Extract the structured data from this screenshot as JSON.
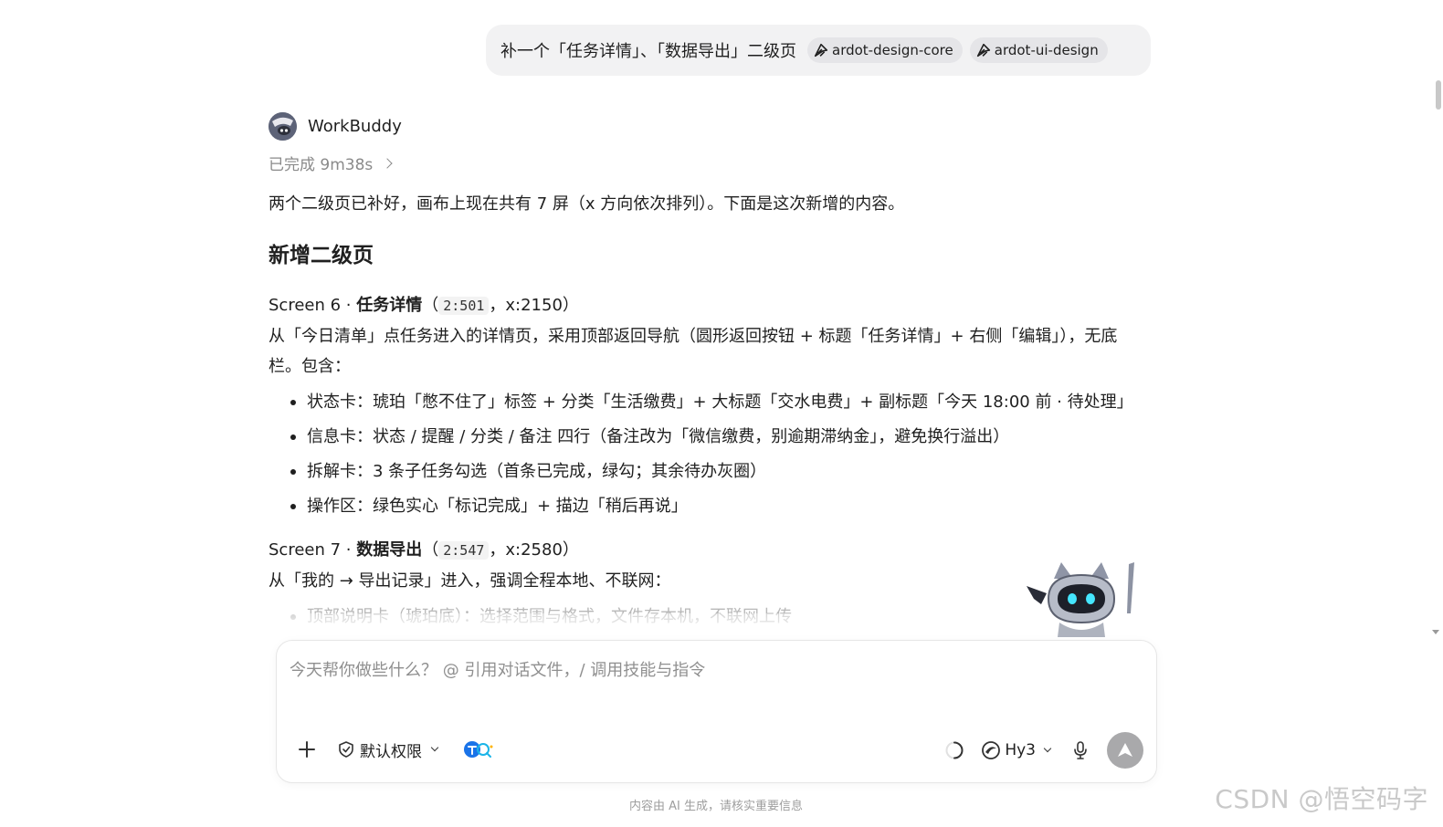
{
  "user_message": {
    "text": "补一个「任务详情」、「数据导出」二级页",
    "skills": [
      {
        "icon": "skill-icon",
        "label": "ardot-design-core"
      },
      {
        "icon": "skill-icon",
        "label": "ardot-ui-design"
      }
    ]
  },
  "assistant": {
    "name": "WorkBuddy",
    "status": "已完成 9m38s",
    "intro": "两个二级页已补好，画布上现在共有 7 屏（x 方向依次排列）。下面是这次新增的内容。",
    "heading": "新增二级页",
    "screen6": {
      "prefix": "Screen 6 · ",
      "title": "任务详情",
      "open": "（",
      "code": "2:501",
      "suffix": "，x:2150）",
      "desc": "从「今日清单」点任务进入的详情页，采用顶部返回导航（圆形返回按钮 + 标题「任务详情」+ 右侧「编辑」），无底栏。包含：",
      "bullets": [
        "状态卡：琥珀「憋不住了」标签 + 分类「生活缴费」+ 大标题「交水电费」+ 副标题「今天 18:00 前 · 待处理」",
        "信息卡：状态 / 提醒 / 分类 / 备注 四行（备注改为「微信缴费，别逾期滞纳金」，避免换行溢出）",
        "拆解卡：3 条子任务勾选（首条已完成，绿勾；其余待办灰圈）",
        "操作区：绿色实心「标记完成」+ 描边「稍后再说」"
      ]
    },
    "screen7": {
      "prefix": "Screen 7 · ",
      "title": "数据导出",
      "open": "（",
      "code": "2:547",
      "suffix": "，x:2580）",
      "desc": "从「我的 → 导出记录」进入，强调全程本地、不联网：",
      "bullets": [
        "顶部说明卡（琥珀底）：选择范围与格式，文件存本机，不联网上传"
      ]
    }
  },
  "composer": {
    "placeholder": "今天帮你做些什么？ @ 引用对话文件，/ 调用技能与指令",
    "permission_label": "默认权限",
    "model_label": "Hy3"
  },
  "footer": {
    "disclaimer": "内容由 AI 生成，请核实重要信息"
  },
  "watermark": "CSDN @悟空码字",
  "colors": {
    "bubble_bg": "#f2f2f3",
    "chip_bg": "#e5e5e8",
    "send_button": "#a9a9ab",
    "muted_text": "#8a8a8a"
  }
}
